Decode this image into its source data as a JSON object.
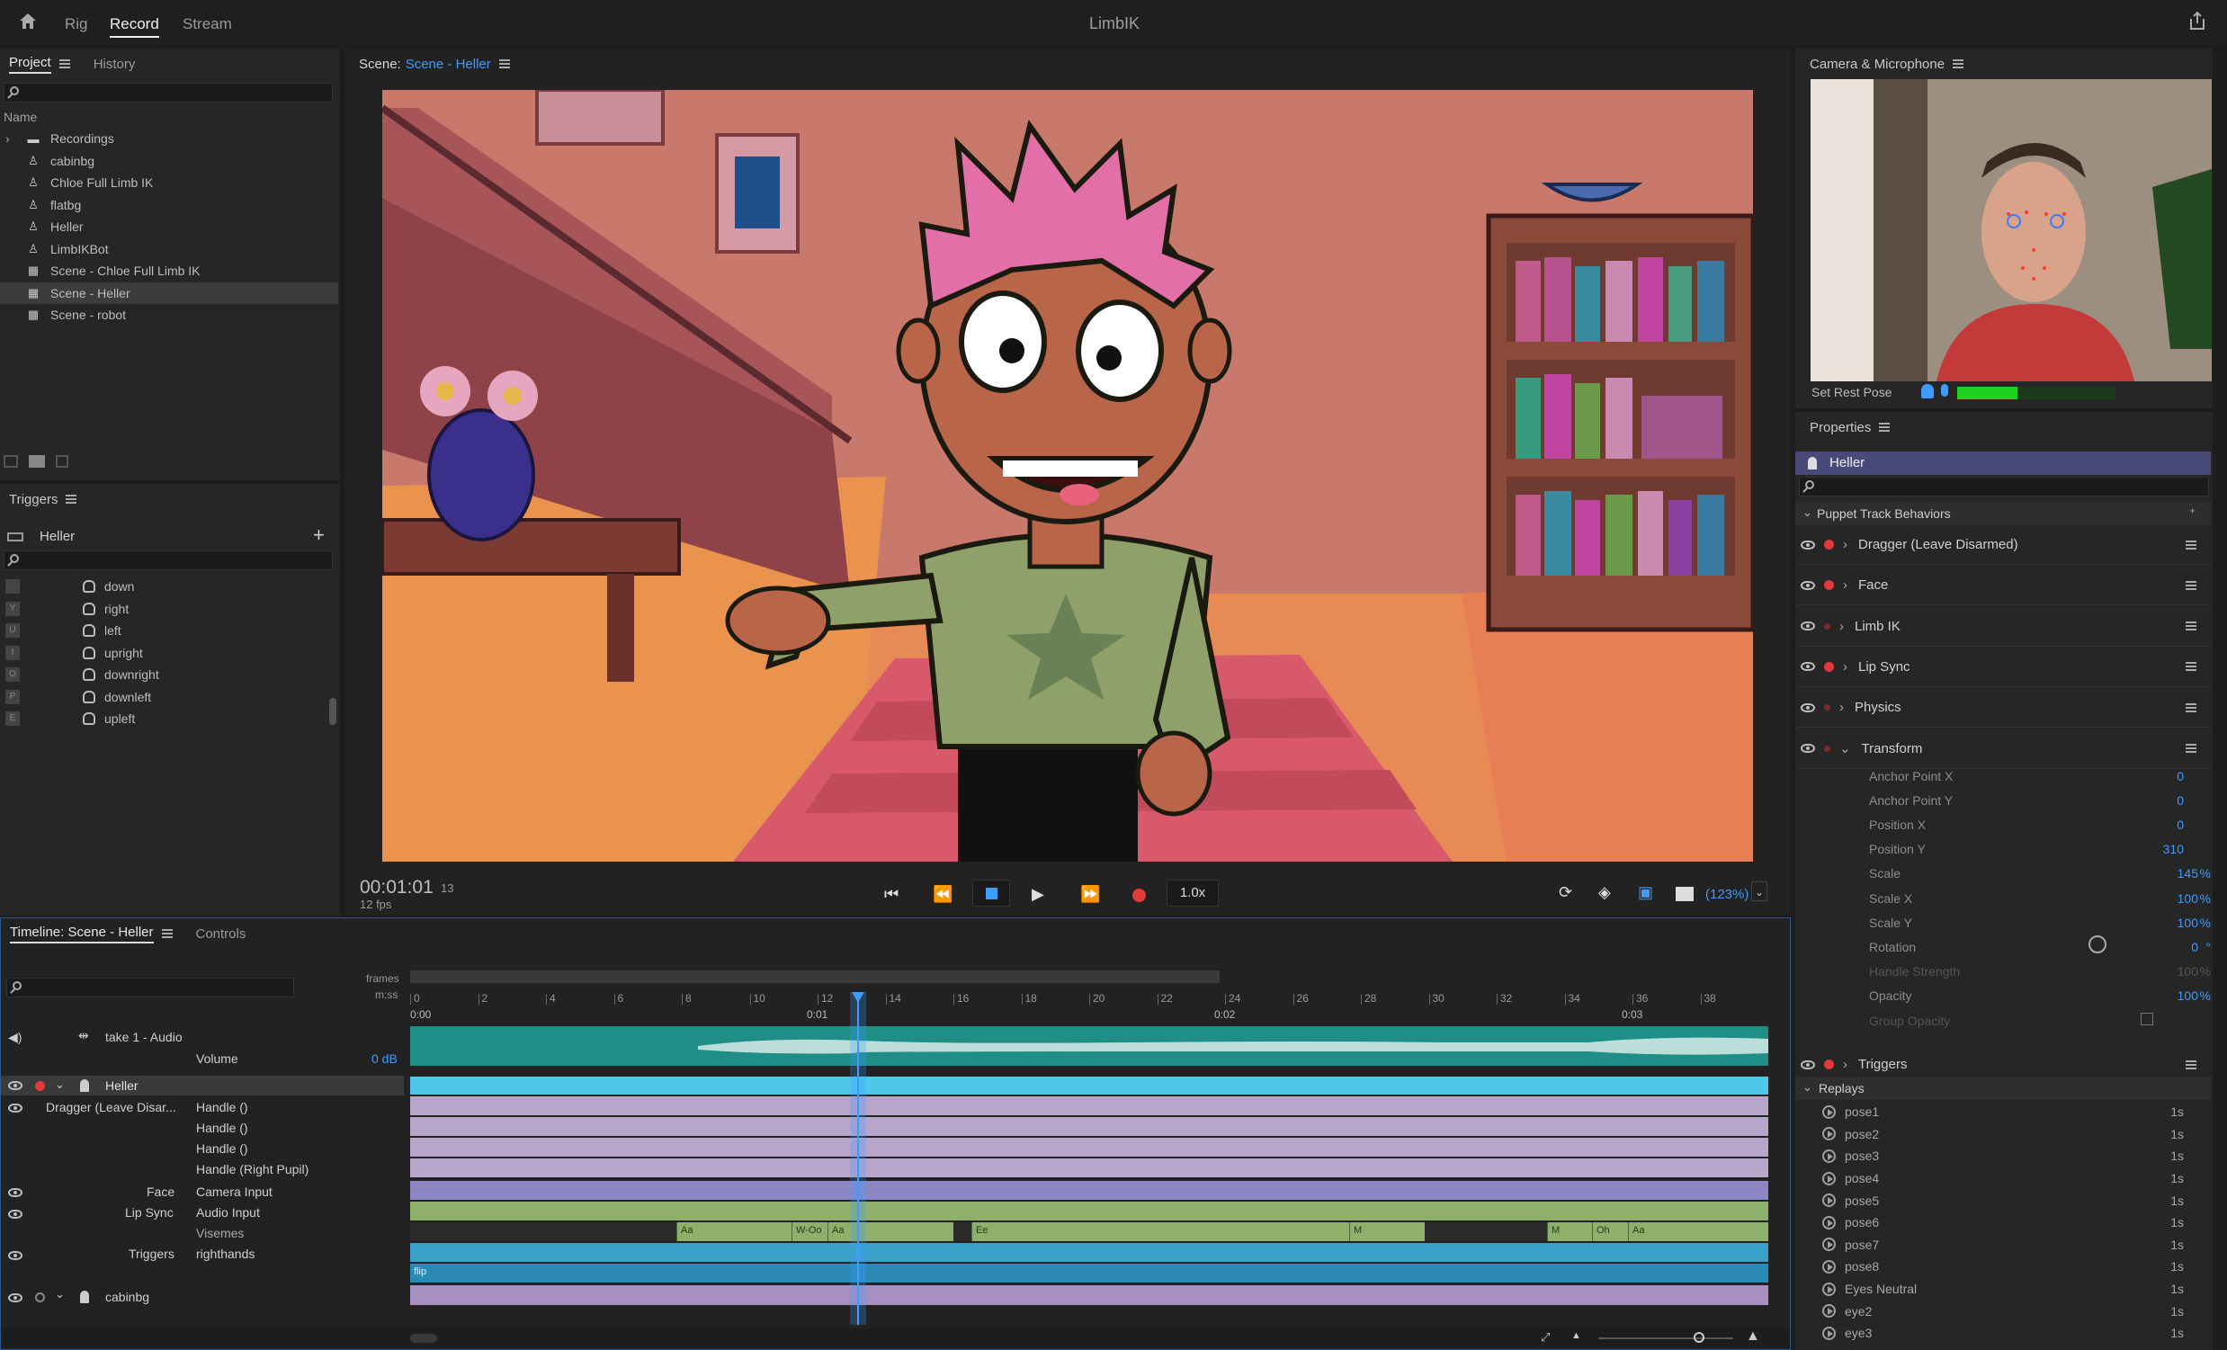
{
  "app": {
    "title": "LimbIK",
    "tabs": [
      "Rig",
      "Record",
      "Stream"
    ],
    "active_tab": "Record"
  },
  "project": {
    "tabs": [
      "Project",
      "History"
    ],
    "column": "Name",
    "items": [
      {
        "label": "Recordings",
        "icon": "folder-icon"
      },
      {
        "label": "cabinbg",
        "icon": "puppet-icon"
      },
      {
        "label": "Chloe Full Limb IK",
        "icon": "puppet-icon"
      },
      {
        "label": "flatbg",
        "icon": "puppet-icon"
      },
      {
        "label": "Heller",
        "icon": "puppet-icon"
      },
      {
        "label": "LimbIKBot",
        "icon": "puppet-icon"
      },
      {
        "label": "Scene - Chloe Full Limb IK",
        "icon": "scene-icon"
      },
      {
        "label": "Scene - Heller",
        "icon": "scene-icon"
      },
      {
        "label": "Scene - robot",
        "icon": "scene-icon"
      }
    ]
  },
  "triggers": {
    "title": "Triggers",
    "puppet": "Heller",
    "items": [
      {
        "key": "",
        "label": "down"
      },
      {
        "key": "Y",
        "label": "right"
      },
      {
        "key": "U",
        "label": "left"
      },
      {
        "key": "I",
        "label": "upright"
      },
      {
        "key": "O",
        "label": "downright"
      },
      {
        "key": "P",
        "label": "downleft"
      },
      {
        "key": "E",
        "label": "upleft"
      }
    ]
  },
  "scene": {
    "label": "Scene:",
    "name": "Scene - Heller",
    "timecode": "00:01:01",
    "frame": "13",
    "fps": "12 fps",
    "speed": "1.0x",
    "zoom": "(123%)"
  },
  "camera": {
    "title": "Camera & Microphone",
    "rest_pose": "Set Rest Pose",
    "audio_level": 0.38
  },
  "properties": {
    "title": "Properties",
    "puppet": "Heller",
    "section": "Puppet Track Behaviors",
    "behaviors": [
      "Dragger (Leave Disarmed)",
      "Face",
      "Limb IK",
      "Lip Sync",
      "Physics",
      "Transform"
    ],
    "transform": [
      {
        "label": "Anchor Point X",
        "value": "0",
        "unit": ""
      },
      {
        "label": "Anchor Point Y",
        "value": "0",
        "unit": ""
      },
      {
        "label": "Position X",
        "value": "0",
        "unit": ""
      },
      {
        "label": "Position Y",
        "value": "310",
        "unit": ""
      },
      {
        "label": "Scale",
        "value": "145",
        "unit": "%"
      },
      {
        "label": "Scale X",
        "value": "100",
        "unit": "%"
      },
      {
        "label": "Scale Y",
        "value": "100",
        "unit": "%"
      },
      {
        "label": "Rotation",
        "value": "0",
        "unit": "°"
      },
      {
        "label": "Handle Strength",
        "value": "100",
        "unit": "%"
      },
      {
        "label": "Opacity",
        "value": "100",
        "unit": "%"
      },
      {
        "label": "Group Opacity",
        "value": "",
        "unit": ""
      }
    ],
    "triggers_label": "Triggers",
    "replays_label": "Replays",
    "replays": [
      {
        "label": "pose1",
        "dur": "1s"
      },
      {
        "label": "pose2",
        "dur": "1s"
      },
      {
        "label": "pose3",
        "dur": "1s"
      },
      {
        "label": "pose4",
        "dur": "1s"
      },
      {
        "label": "pose5",
        "dur": "1s"
      },
      {
        "label": "pose6",
        "dur": "1s"
      },
      {
        "label": "pose7",
        "dur": "1s"
      },
      {
        "label": "pose8",
        "dur": "1s"
      },
      {
        "label": "Eyes Neutral",
        "dur": "1s"
      },
      {
        "label": "eye2",
        "dur": "1s"
      },
      {
        "label": "eye3",
        "dur": "1s"
      }
    ]
  },
  "timeline": {
    "title": "Timeline: Scene - Heller",
    "controls_tab": "Controls",
    "frames_label": "frames",
    "mss_label": "m:ss",
    "frame_ticks": [
      "0",
      "2",
      "4",
      "6",
      "8",
      "10",
      "12",
      "14",
      "16",
      "18",
      "20",
      "22",
      "24",
      "26",
      "28",
      "30",
      "32",
      "34",
      "36",
      "38"
    ],
    "time_ticks": [
      "0:00",
      "0:01",
      "0:02",
      "0:03"
    ],
    "audio_track": "take 1 - Audio",
    "volume_label": "Volume",
    "volume_value": "0 dB",
    "puppet_track": "Heller",
    "dragger": "Dragger (Leave Disar...",
    "handles": [
      "Handle ()",
      "Handle ()",
      "Handle ()",
      "Handle (Right Pupil)"
    ],
    "face": "Face",
    "face_input": "Camera Input",
    "lipsync": "Lip Sync",
    "lipsync_input": "Audio Input",
    "visemes": "Visemes",
    "triggers": "Triggers",
    "triggers_value": "righthands",
    "flip_label": "flip",
    "cabin_track": "cabinbg",
    "viseme_labels": [
      "Aa",
      "W-Oo",
      "Aa",
      "Ee",
      "M",
      "M",
      "Oh",
      "Aa"
    ]
  }
}
